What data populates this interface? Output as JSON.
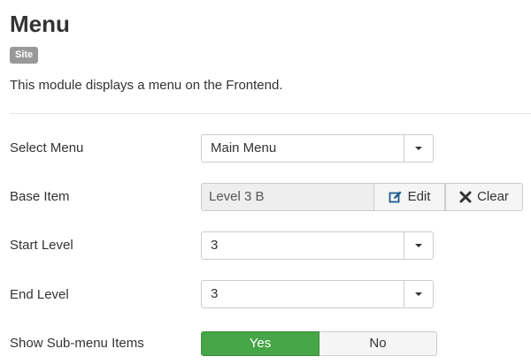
{
  "header": {
    "title": "Menu",
    "badge": "Site",
    "description": "This module displays a menu on the Frontend."
  },
  "fields": {
    "select_menu": {
      "label": "Select Menu",
      "value": "Main Menu"
    },
    "base_item": {
      "label": "Base Item",
      "value": "Level 3 B",
      "edit_label": "Edit",
      "clear_label": "Clear"
    },
    "start_level": {
      "label": "Start Level",
      "value": "3"
    },
    "end_level": {
      "label": "End Level",
      "value": "3"
    },
    "show_submenu": {
      "label": "Show Sub-menu Items",
      "yes_label": "Yes",
      "no_label": "No",
      "selected": "Yes"
    }
  },
  "icons": {
    "select_caret": "chevron-down-icon",
    "edit": "edit-icon",
    "clear": "close-icon"
  },
  "colors": {
    "badge": "#999999",
    "toggle_active": "#46a546"
  }
}
